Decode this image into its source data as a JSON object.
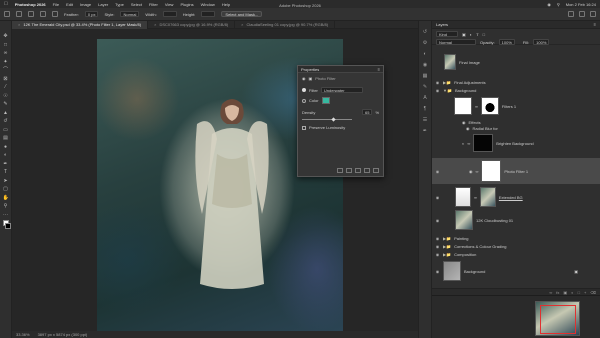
{
  "menubar": {
    "app": "Photoshop 2026",
    "items": [
      "File",
      "Edit",
      "Image",
      "Layer",
      "Type",
      "Select",
      "Filter",
      "View",
      "Plugins",
      "Window",
      "Help"
    ],
    "datetime": "Mon 2 Feb 16:24"
  },
  "optbar": {
    "window_title": "Adobe Photoshop 2026",
    "feather_label": "Feather:",
    "feather_value": "0 px",
    "style_label": "Style:",
    "style_value": "Normal",
    "width_label": "Width:",
    "height_label": "Height:",
    "select_mask_label": "Select and Mask..."
  },
  "tabs": [
    {
      "label": "12K The Emerald City.psd @ 33.4% (Photo Filter 1, Layer Mask/8)",
      "active": true
    },
    {
      "label": "DSC07663 copy.jpg @ 16.9% (RGB/8)",
      "active": false
    },
    {
      "label": "ClaudiaSeeling 01 copy.jpg @ 90.7% (RGB/8)",
      "active": false
    }
  ],
  "statusbar": {
    "zoom": "33.36%",
    "doc": "3897 px x 5874 px (300 ppi)"
  },
  "properties": {
    "title": "Properties",
    "subtitle": "Photo Filter",
    "filter_label": "Filter",
    "filter_value": "Underwater",
    "color_label": "Color",
    "density_label": "Density",
    "density_value": "65",
    "density_unit": "%",
    "preserve_label": "Preserve Luminosity"
  },
  "layers": {
    "tabs": [
      "Layers"
    ],
    "kind_label": "Kind",
    "blend_mode": "Normal",
    "opacity_label": "Opacity:",
    "opacity_value": "100%",
    "lock_label": "Lock:",
    "fill_label": "Fill:",
    "fill_value": "100%",
    "items": [
      {
        "name": "Final Image",
        "type": "image"
      },
      {
        "name": "Final Adjustments",
        "type": "group"
      },
      {
        "name": "Background",
        "type": "group"
      },
      {
        "name": "Filters 1",
        "type": "mask"
      },
      {
        "name": "Effects",
        "type": "fx"
      },
      {
        "name": "Radial Blur for",
        "type": "fx-item"
      },
      {
        "name": "Brighten Background",
        "type": "adjustment"
      },
      {
        "name": "Photo Filter 1",
        "type": "adjustment",
        "selected": true
      },
      {
        "name": "Extended BG",
        "type": "image"
      },
      {
        "name": "12K Cloudbusting 01",
        "type": "image"
      },
      {
        "name": "Painting",
        "type": "group"
      },
      {
        "name": "Corrections & Colour Grading",
        "type": "group"
      },
      {
        "name": "Composition",
        "type": "group"
      },
      {
        "name": "Background",
        "type": "image"
      }
    ]
  },
  "icons": {
    "eye": "eye-icon",
    "folder": "folder-icon",
    "chain": "chain-icon"
  }
}
